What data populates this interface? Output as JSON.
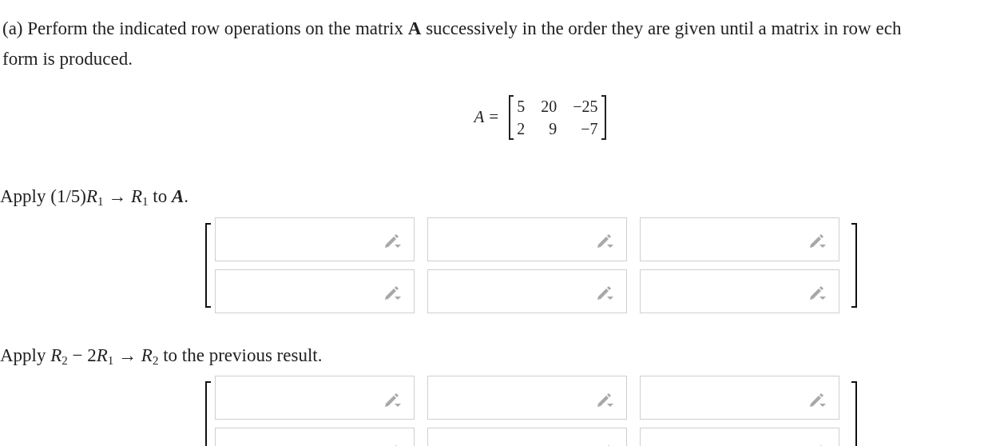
{
  "intro": [
    "(a) Perform the indicated row operations on the matrix **A** successively in the order they are given until a matrix in row ech",
    "form is produced."
  ],
  "matrix": {
    "label": "A =",
    "rows": [
      [
        "5",
        "20",
        "−25"
      ],
      [
        "2",
        "9",
        "−7"
      ]
    ]
  },
  "steps": [
    {
      "instruction": [
        {
          "kind": "plain",
          "text": "Apply (1/5)"
        },
        {
          "kind": "var",
          "text": "R"
        },
        {
          "kind": "sub",
          "text": "1"
        },
        {
          "kind": "plain",
          "text": " → "
        },
        {
          "kind": "var",
          "text": "R"
        },
        {
          "kind": "sub",
          "text": "1"
        },
        {
          "kind": "plain",
          "text": " to "
        },
        {
          "kind": "bold",
          "text": "A"
        },
        {
          "kind": "plain",
          "text": "."
        }
      ],
      "answer": [
        [
          {
            "kind": "entry"
          },
          {
            "kind": "entry"
          },
          {
            "kind": "entry"
          }
        ],
        [
          {
            "kind": "entry"
          },
          {
            "kind": "entry"
          },
          {
            "kind": "entry"
          }
        ]
      ]
    },
    {
      "instruction": [
        {
          "kind": "plain",
          "text": "Apply "
        },
        {
          "kind": "var",
          "text": "R"
        },
        {
          "kind": "sub",
          "text": "2"
        },
        {
          "kind": "plain",
          "text": " − 2"
        },
        {
          "kind": "var",
          "text": "R"
        },
        {
          "kind": "sub",
          "text": "1"
        },
        {
          "kind": "plain",
          "text": " → "
        },
        {
          "kind": "var",
          "text": "R"
        },
        {
          "kind": "sub",
          "text": "2"
        },
        {
          "kind": "plain",
          "text": " to the previous result."
        }
      ],
      "answer": [
        [
          {
            "kind": "entry"
          },
          {
            "kind": "entry"
          },
          {
            "kind": "entry"
          }
        ],
        [
          {
            "kind": "entry"
          },
          {
            "kind": "entry"
          },
          {
            "kind": "entry"
          }
        ]
      ]
    }
  ]
}
